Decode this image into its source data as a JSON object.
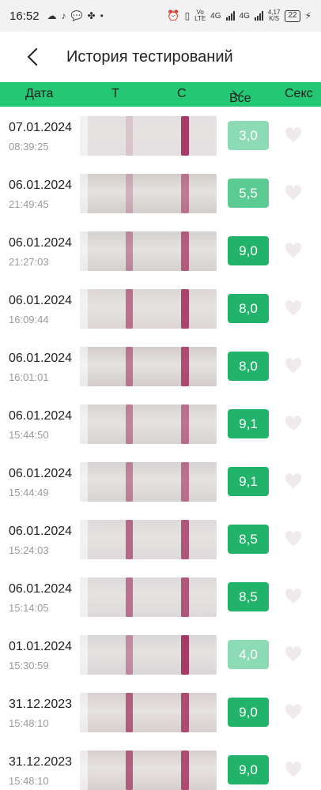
{
  "statusbar": {
    "time": "16:52",
    "net": "Vo LTE",
    "sig1": "4G",
    "sig2": "4G",
    "speed_value": "4,17",
    "speed_unit": "K/S",
    "battery": "22"
  },
  "header": {
    "title": "История тестирований"
  },
  "columns": {
    "date": "Дата",
    "t": "T",
    "c": "C",
    "all": "Все",
    "sex": "Секс"
  },
  "colors": {
    "accent": "#23c774",
    "score_strong": "#22b36b",
    "score_light": "#8ddbb5",
    "heart": "#f1eaea"
  },
  "rows": [
    {
      "date": "07.01.2024",
      "time": "08:39:25",
      "score": "3,0",
      "level": "light",
      "t_intensity": 0.15,
      "c_intensity": 0.9,
      "bg": "#e4dfe1"
    },
    {
      "date": "06.01.2024",
      "time": "21:49:45",
      "score": "5,5",
      "level": "mid",
      "t_intensity": 0.25,
      "c_intensity": 0.55,
      "bg": "#d1cdca"
    },
    {
      "date": "06.01.2024",
      "time": "21:27:03",
      "score": "9,0",
      "level": "strong",
      "t_intensity": 0.45,
      "c_intensity": 0.7,
      "bg": "#d4d0cd"
    },
    {
      "date": "06.01.2024",
      "time": "16:09:44",
      "score": "8,0",
      "level": "strong",
      "t_intensity": 0.6,
      "c_intensity": 0.85,
      "bg": "#dcd7d6"
    },
    {
      "date": "06.01.2024",
      "time": "16:01:01",
      "score": "8,0",
      "level": "strong",
      "t_intensity": 0.55,
      "c_intensity": 0.8,
      "bg": "#d2cdcb"
    },
    {
      "date": "06.01.2024",
      "time": "15:44:50",
      "score": "9,1",
      "level": "strong",
      "t_intensity": 0.5,
      "c_intensity": 0.6,
      "bg": "#d6d3d3"
    },
    {
      "date": "06.01.2024",
      "time": "15:44:49",
      "score": "9,1",
      "level": "strong",
      "t_intensity": 0.5,
      "c_intensity": 0.6,
      "bg": "#d6d3d3"
    },
    {
      "date": "06.01.2024",
      "time": "15:24:03",
      "score": "8,5",
      "level": "strong",
      "t_intensity": 0.65,
      "c_intensity": 0.75,
      "bg": "#dedadb"
    },
    {
      "date": "06.01.2024",
      "time": "15:14:05",
      "score": "8,5",
      "level": "strong",
      "t_intensity": 0.6,
      "c_intensity": 0.75,
      "bg": "#dedadb"
    },
    {
      "date": "01.01.2024",
      "time": "15:30:59",
      "score": "4,0",
      "level": "light",
      "t_intensity": 0.45,
      "c_intensity": 0.9,
      "bg": "#d9d6d8"
    },
    {
      "date": "31.12.2023",
      "time": "15:48:10",
      "score": "9,0",
      "level": "strong",
      "t_intensity": 0.7,
      "c_intensity": 0.8,
      "bg": "#d6cfcd"
    },
    {
      "date": "31.12.2023",
      "time": "15:48:10",
      "score": "9,0",
      "level": "strong",
      "t_intensity": 0.7,
      "c_intensity": 0.8,
      "bg": "#d6cfcd"
    }
  ]
}
